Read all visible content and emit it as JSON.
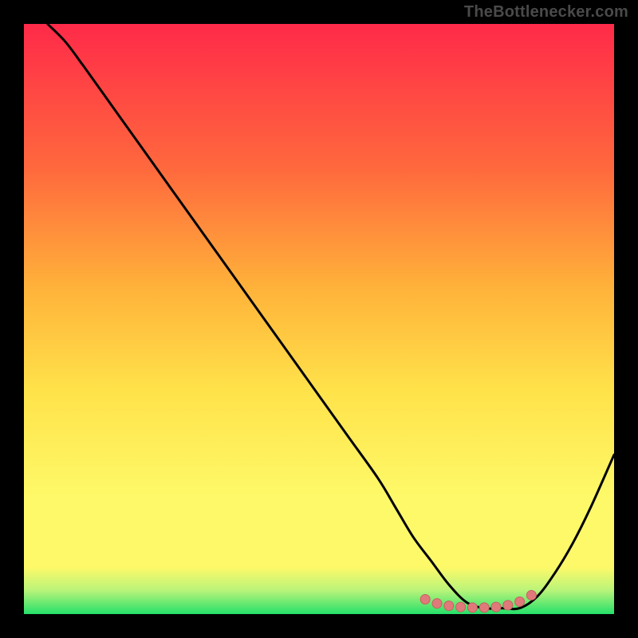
{
  "watermark": {
    "text": "TheBottlenecker.com"
  },
  "colors": {
    "background": "#000000",
    "gradient_top": "#ff2a49",
    "gradient_mid_upper": "#ff6a3d",
    "gradient_mid": "#ffb33a",
    "gradient_mid_lower": "#ffe24a",
    "gradient_yellow": "#fef968",
    "gradient_green_light": "#b9f47a",
    "gradient_green": "#25e06a",
    "curve": "#000000",
    "marker_fill": "#e07a7a",
    "marker_stroke": "#c86060"
  },
  "chart_data": {
    "type": "line",
    "title": "",
    "xlabel": "",
    "ylabel": "",
    "xlim": [
      0,
      100
    ],
    "ylim": [
      0,
      100
    ],
    "legend": false,
    "grid": false,
    "series": [
      {
        "name": "bottleneck-curve",
        "x": [
          4,
          7,
          10,
          15,
          20,
          25,
          30,
          35,
          40,
          45,
          50,
          55,
          60,
          63,
          66,
          69,
          72,
          75,
          78,
          81,
          84,
          87,
          90,
          93,
          96,
          100
        ],
        "y": [
          100,
          97,
          93,
          86,
          79,
          72,
          65,
          58,
          51,
          44,
          37,
          30,
          23,
          18,
          13,
          9,
          5,
          2,
          1,
          1,
          1,
          3,
          7,
          12,
          18,
          27
        ]
      }
    ],
    "markers": {
      "name": "optimal-range",
      "x": [
        68,
        70,
        72,
        74,
        76,
        78,
        80,
        82,
        84,
        86
      ],
      "y": [
        2.5,
        1.8,
        1.4,
        1.2,
        1.1,
        1.1,
        1.2,
        1.5,
        2.1,
        3.2
      ]
    },
    "gradient_stops_pct": [
      0,
      25,
      45,
      62,
      80,
      92,
      96,
      100
    ]
  }
}
